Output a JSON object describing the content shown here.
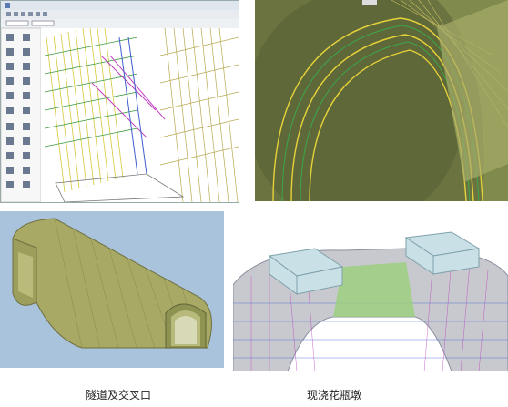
{
  "panels": [
    {
      "id": "software-screenshot",
      "title_bar_text": "",
      "toolbar_labels": [
        "",
        "",
        ""
      ]
    },
    {
      "id": "tunnel-closeup"
    },
    {
      "id": "tunnel-with-intersection"
    },
    {
      "id": "cast-in-place-pier"
    }
  ],
  "captions": {
    "left": "隧道及交叉口",
    "right": "现浇花瓶墩"
  },
  "colors": {
    "concrete_green": "#9aa05a",
    "rebar_yellow": "#e6d23a",
    "rebar_magenta": "#c040c0",
    "rebar_blue": "#4060d0",
    "sky_blue": "#a9c3dc",
    "pier_cap_glass": "#c8e0e6"
  }
}
